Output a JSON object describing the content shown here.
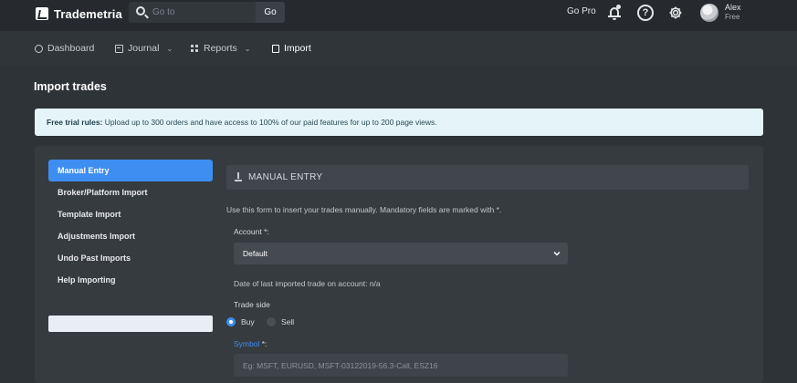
{
  "brand": {
    "name": "Trademetria"
  },
  "search": {
    "placeholder": "Go to",
    "button": "Go"
  },
  "topnav": {
    "gopro": "Go Pro",
    "help_glyph": "?",
    "user_name": "Alex",
    "user_plan": "Free"
  },
  "subnav": {
    "items": [
      {
        "label": "Dashboard",
        "icon": "dashboard-icon"
      },
      {
        "label": "Journal",
        "icon": "calendar-icon",
        "dropdown": true
      },
      {
        "label": "Reports",
        "icon": "grid-icon",
        "dropdown": true
      },
      {
        "label": "Import",
        "icon": "file-icon",
        "active": true
      }
    ],
    "chevron": "⌄"
  },
  "page": {
    "title": "Import trades"
  },
  "alert": {
    "bold": "Free trial rules:",
    "text": " Upload up to 300 orders and have access to 100% of our paid features for up to 200 page views."
  },
  "sidebar": {
    "items": [
      {
        "label": "Manual Entry",
        "active": true
      },
      {
        "label": "Broker/Platform Import"
      },
      {
        "label": "Template Import"
      },
      {
        "label": "Adjustments Import"
      },
      {
        "label": "Undo Past Imports"
      },
      {
        "label": "Help Importing"
      }
    ]
  },
  "panel": {
    "title": "MANUAL ENTRY",
    "intro": "Use this form to insert your trades manually. Mandatory fields are marked with *.",
    "account_label": "Account *:",
    "account_value": "Default",
    "last_trade": "Date of last imported trade on account: n/a",
    "side_label": "Trade side",
    "side_buy": "Buy",
    "side_sell": "Sell",
    "side_selected": "Buy",
    "symbol_label": "Symbol",
    "symbol_req": " *:",
    "symbol_placeholder": "Eg: MSFT, EURUSD, MSFT-03122019-56.3-Call, ESZ16"
  },
  "colors": {
    "accent": "#3d8ef0",
    "alert_bg": "#e4f4f8"
  }
}
